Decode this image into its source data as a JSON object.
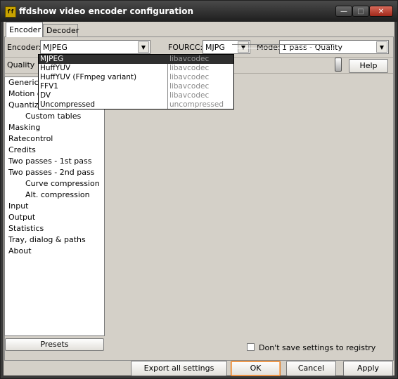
{
  "window": {
    "title": "ffdshow video encoder configuration",
    "icon_label": "ff",
    "min_glyph": "—",
    "max_glyph": "□",
    "close_glyph": "✕"
  },
  "tabs": [
    {
      "label": "Encoder",
      "active": true
    },
    {
      "label": "Decoder",
      "active": false
    }
  ],
  "encoder": {
    "label": "Encoder:",
    "value": "MJPEG",
    "arrow": "▼"
  },
  "fourcc": {
    "label": "FOURCC:",
    "value": "MJPG",
    "arrow": "▼"
  },
  "mode": {
    "label": "Mode:",
    "value": "1 pass - Quality",
    "arrow": "▼"
  },
  "quality": {
    "label": "Quality"
  },
  "help_button": "Help",
  "dropdown": {
    "items": [
      {
        "name": "MJPEG",
        "codec": "libavcodec",
        "selected": true
      },
      {
        "name": "HuffYUV",
        "codec": "libavcodec",
        "selected": false
      },
      {
        "name": "HuffYUV (FFmpeg variant)",
        "codec": "libavcodec",
        "selected": false
      },
      {
        "name": "FFV1",
        "codec": "libavcodec",
        "selected": false
      },
      {
        "name": "DV",
        "codec": "libavcodec",
        "selected": false
      },
      {
        "name": "Uncompressed",
        "codec": "uncompressed",
        "selected": false
      }
    ]
  },
  "tree": {
    "items": [
      {
        "label": "Generic",
        "indent": 0
      },
      {
        "label": "Motion e",
        "indent": 0
      },
      {
        "label": "Quantiza",
        "indent": 0
      },
      {
        "label": "Custom tables",
        "indent": 1
      },
      {
        "label": "Masking",
        "indent": 0
      },
      {
        "label": "Ratecontrol",
        "indent": 0
      },
      {
        "label": "Credits",
        "indent": 0
      },
      {
        "label": "Two passes - 1st pass",
        "indent": 0
      },
      {
        "label": "Two passes - 2nd pass",
        "indent": 0
      },
      {
        "label": "Curve compression",
        "indent": 1
      },
      {
        "label": "Alt. compression",
        "indent": 1
      },
      {
        "label": "Input",
        "indent": 0
      },
      {
        "label": "Output",
        "indent": 0
      },
      {
        "label": "Statistics",
        "indent": 0
      },
      {
        "label": "Tray, dialog & paths",
        "indent": 0
      },
      {
        "label": "About",
        "indent": 0
      }
    ]
  },
  "presets_button": "Presets",
  "dont_save": {
    "label": "Don't save settings to registry",
    "checked": false
  },
  "footer": {
    "export": "Export all settings",
    "ok": "OK",
    "cancel": "Cancel",
    "apply": "Apply"
  }
}
